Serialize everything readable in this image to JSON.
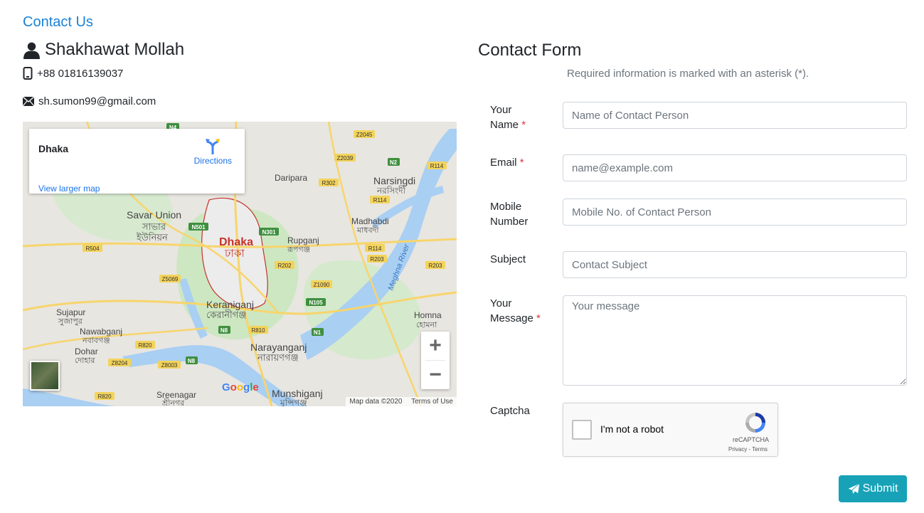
{
  "page": {
    "breadcrumb": "Contact Us"
  },
  "contact": {
    "name": "Shakhawat Mollah",
    "phone": "+88 01816139037",
    "email": "sh.sumon99@gmail.com",
    "icons": [
      "user-icon",
      "mobile-icon",
      "envelope-icon"
    ]
  },
  "map": {
    "place": "Dhaka",
    "directions_label": "Directions",
    "larger_map_label": "View larger map",
    "zoom_in": "+",
    "zoom_out": "−",
    "logo": "Google",
    "attribution": "Map data ©2020",
    "terms": "Terms of Use",
    "labels": [
      {
        "text": "Savar Union",
        "cls": "city"
      },
      {
        "text": "সাভার",
        "cls": "city-bn"
      },
      {
        "text": "ইউনিয়ন",
        "cls": "city-bn"
      },
      {
        "text": "Dhaka",
        "cls": "capital"
      },
      {
        "text": "ঢাকা",
        "cls": "capital-bn"
      },
      {
        "text": "Keraniganj",
        "cls": "city"
      },
      {
        "text": "কেরানীগঞ্জ",
        "cls": "city-bn"
      },
      {
        "text": "Narayanganj",
        "cls": "city"
      },
      {
        "text": "নারায়ণগঞ্জ",
        "cls": "city-bn"
      },
      {
        "text": "Munshiganj",
        "cls": "city"
      },
      {
        "text": "মুন্সিগঞ্জ",
        "cls": "city-bn"
      },
      {
        "text": "Narsingdi",
        "cls": "city"
      },
      {
        "text": "নরসিংদী",
        "cls": "city-bn"
      },
      {
        "text": "Madhabdi",
        "cls": "town"
      },
      {
        "text": "মাধবদী",
        "cls": "town-bn"
      },
      {
        "text": "Daripara",
        "cls": "town"
      },
      {
        "text": "Rupganj",
        "cls": "town"
      },
      {
        "text": "রূপগঞ্জ",
        "cls": "town-bn"
      },
      {
        "text": "Sujapur",
        "cls": "town"
      },
      {
        "text": "সুজাপুর",
        "cls": "town-bn"
      },
      {
        "text": "Nawabganj",
        "cls": "town"
      },
      {
        "text": "নবাবগঞ্জ",
        "cls": "town-bn"
      },
      {
        "text": "Dohar",
        "cls": "town"
      },
      {
        "text": "দোহার",
        "cls": "town-bn"
      },
      {
        "text": "Sreenagar",
        "cls": "town"
      },
      {
        "text": "শ্রীনগর",
        "cls": "town-bn"
      },
      {
        "text": "Homna",
        "cls": "town"
      },
      {
        "text": "হোমনা",
        "cls": "town-bn"
      },
      {
        "text": "Meghna River",
        "cls": "river"
      }
    ],
    "roads": [
      {
        "text": "N4",
        "color": "#3f8f3f"
      },
      {
        "text": "Z2045",
        "color": "#f3d35a"
      },
      {
        "text": "Z2039",
        "color": "#f3d35a"
      },
      {
        "text": "N2",
        "color": "#3f8f3f"
      },
      {
        "text": "R114",
        "color": "#f3d35a"
      },
      {
        "text": "R302",
        "color": "#f3d35a"
      },
      {
        "text": "R114",
        "color": "#f3d35a"
      },
      {
        "text": "N501",
        "color": "#3f8f3f"
      },
      {
        "text": "N301",
        "color": "#3f8f3f"
      },
      {
        "text": "R504",
        "color": "#f3d35a"
      },
      {
        "text": "R114",
        "color": "#f3d35a"
      },
      {
        "text": "R203",
        "color": "#f3d35a"
      },
      {
        "text": "R202",
        "color": "#f3d35a"
      },
      {
        "text": "R203",
        "color": "#f3d35a"
      },
      {
        "text": "Z5069",
        "color": "#f3d35a"
      },
      {
        "text": "Z1090",
        "color": "#f3d35a"
      },
      {
        "text": "N105",
        "color": "#3f8f3f"
      },
      {
        "text": "N8",
        "color": "#3f8f3f"
      },
      {
        "text": "R810",
        "color": "#f3d35a"
      },
      {
        "text": "N1",
        "color": "#3f8f3f"
      },
      {
        "text": "R820",
        "color": "#f3d35a"
      },
      {
        "text": "Z8204",
        "color": "#f3d35a"
      },
      {
        "text": "Z8003",
        "color": "#f3d35a"
      },
      {
        "text": "N8",
        "color": "#3f8f3f"
      },
      {
        "text": "R820",
        "color": "#f3d35a"
      }
    ]
  },
  "form": {
    "title": "Contact Form",
    "required_note": "Required information is marked with an asterisk (*).",
    "asterisk": "*",
    "fields": {
      "name": {
        "label_line1": "Your",
        "label_line2": "Name",
        "placeholder": "Name of Contact Person",
        "required": true
      },
      "email": {
        "label_line1": "Email",
        "placeholder": "name@example.com",
        "required": true
      },
      "mobile": {
        "label_line1": "Mobile",
        "label_line2": "Number",
        "placeholder": "Mobile No. of Contact Person",
        "required": false
      },
      "subject": {
        "label_line1": "Subject",
        "placeholder": "Contact Subject",
        "required": false
      },
      "message": {
        "label_line1": "Your",
        "label_line2": "Message",
        "placeholder": "Your message",
        "required": true
      }
    },
    "captcha": {
      "label": "Captcha",
      "checkbox_label": "I'm not a robot",
      "brand": "reCAPTCHA",
      "terms": "Privacy - Terms"
    },
    "submit_label": "Submit",
    "submit_icon": "paper-plane-icon",
    "colors": {
      "accent": "#17a2b8",
      "link": "#1a82d8",
      "required": "#dc3545"
    }
  }
}
